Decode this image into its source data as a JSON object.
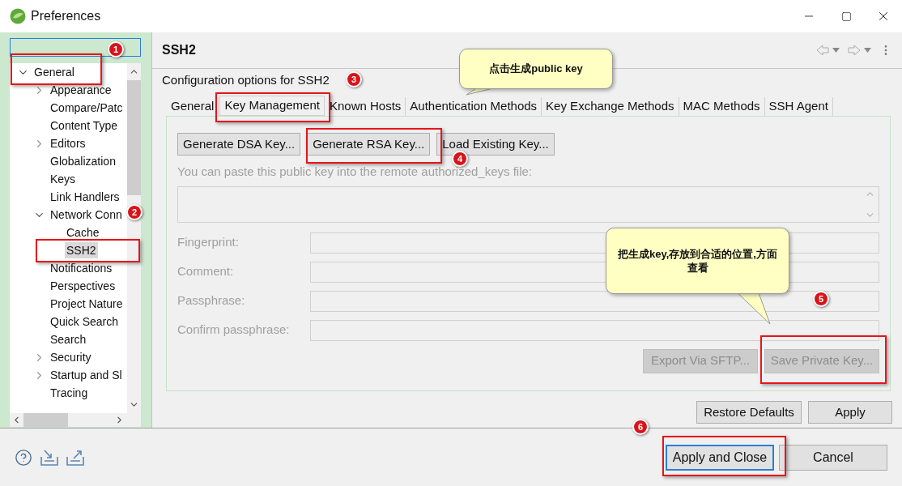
{
  "window": {
    "title": "Preferences"
  },
  "tree": [
    {
      "label": "General",
      "kind": "group",
      "expanded": true,
      "selected": false,
      "children": [
        {
          "label": "Appearance",
          "kind": "group",
          "expanded": false,
          "selected": false
        },
        {
          "label": "Compare/Patc",
          "kind": "page",
          "selected": false
        },
        {
          "label": "Content Type",
          "kind": "page",
          "selected": false
        },
        {
          "label": "Editors",
          "kind": "group",
          "expanded": false,
          "selected": false
        },
        {
          "label": "Globalization",
          "kind": "page",
          "selected": false
        },
        {
          "label": "Keys",
          "kind": "page",
          "selected": false
        },
        {
          "label": "Link Handlers",
          "kind": "page",
          "selected": false
        },
        {
          "label": "Network Conn",
          "kind": "group",
          "expanded": true,
          "selected": false,
          "children": [
            {
              "label": "Cache",
              "kind": "page",
              "selected": false
            },
            {
              "label": "SSH2",
              "kind": "page",
              "selected": true
            }
          ]
        },
        {
          "label": "Notifications",
          "kind": "page",
          "selected": false
        },
        {
          "label": "Perspectives",
          "kind": "page",
          "selected": false
        },
        {
          "label": "Project Nature",
          "kind": "page",
          "selected": false
        },
        {
          "label": "Quick Search",
          "kind": "page",
          "selected": false
        },
        {
          "label": "Search",
          "kind": "page",
          "selected": false
        },
        {
          "label": "Security",
          "kind": "group",
          "expanded": false,
          "selected": false
        },
        {
          "label": "Startup and Sl",
          "kind": "group",
          "expanded": false,
          "selected": false
        },
        {
          "label": "Tracing",
          "kind": "page",
          "selected": false
        }
      ]
    }
  ],
  "page": {
    "title": "SSH2",
    "description": "Configuration options for SSH2"
  },
  "tabs": [
    {
      "label": "General",
      "selected": false
    },
    {
      "label": "Key Management",
      "selected": true
    },
    {
      "label": "Known Hosts",
      "selected": false
    },
    {
      "label": "Authentication Methods",
      "selected": false
    },
    {
      "label": "Key Exchange Methods",
      "selected": false
    },
    {
      "label": "MAC Methods",
      "selected": false
    },
    {
      "label": "SSH Agent",
      "selected": false
    }
  ],
  "key_buttons": [
    {
      "label": "Generate DSA Key...",
      "disabled": false
    },
    {
      "label": "Generate RSA Key...",
      "disabled": false
    },
    {
      "label": "Load Existing Key...",
      "disabled": false
    }
  ],
  "hint": {
    "text": "You can paste this public key into the remote authorized_keys file:",
    "disabled": true
  },
  "fields": [
    {
      "label": "Fingerprint:",
      "disabled": true
    },
    {
      "label": "Comment:",
      "disabled": true
    },
    {
      "label": "Passphrase:",
      "disabled": true
    },
    {
      "label": "Confirm passphrase:",
      "disabled": true
    }
  ],
  "export_buttons": [
    {
      "label": "Export Via SFTP...",
      "disabled": true
    },
    {
      "label": "Save Private Key...",
      "disabled": true
    }
  ],
  "page_buttons": [
    {
      "label": "Restore Defaults"
    },
    {
      "label": "Apply"
    }
  ],
  "dialog_buttons": [
    {
      "label": "Apply and Close",
      "default": true
    },
    {
      "label": "Cancel",
      "default": false
    }
  ],
  "annotations": {
    "steps": [
      "1",
      "2",
      "3",
      "4",
      "5",
      "6"
    ],
    "callouts": [
      "点击生成public key",
      "把生成key,存放到合适的位置,方面查看"
    ]
  }
}
